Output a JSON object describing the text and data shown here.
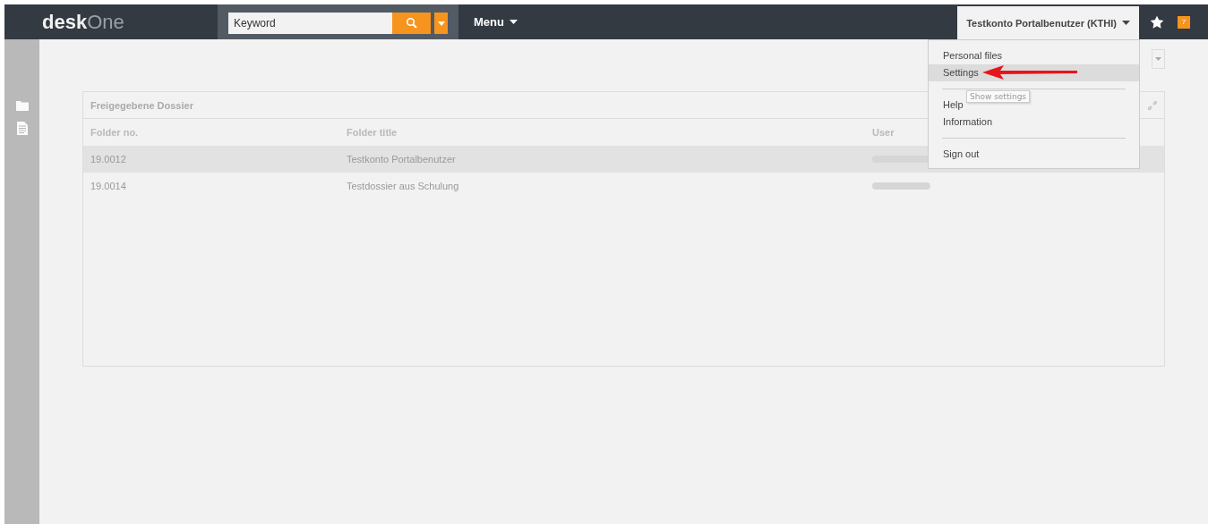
{
  "top_bar": {
    "logo": {
      "bold": "desk",
      "light": "One"
    },
    "search": {
      "placeholder": "Keyword"
    },
    "menu": "Menu",
    "user": "Testkonto Portalbenutzer (KTHI)",
    "notification_count": "7"
  },
  "user_menu": {
    "items": [
      {
        "kind": "item",
        "label": "Personal files",
        "selected": false
      },
      {
        "kind": "item",
        "label": "Settings",
        "selected": true
      },
      {
        "kind": "divider"
      },
      {
        "kind": "item",
        "label": "Help",
        "selected": false
      },
      {
        "kind": "item",
        "label": "Information",
        "selected": false
      },
      {
        "kind": "divider"
      },
      {
        "kind": "item",
        "label": "Sign out",
        "selected": false
      }
    ]
  },
  "tooltip": "Show settings",
  "panel": {
    "title": "Freigegebene Dossier",
    "columns": [
      "Folder no.",
      "Folder title",
      "User"
    ],
    "rows": [
      {
        "cells": [
          "19.0012",
          "Testkonto Portalbenutzer"
        ],
        "selected": true
      },
      {
        "cells": [
          "19.0014",
          "Testdossier aus Schulung"
        ],
        "selected": false
      }
    ]
  }
}
